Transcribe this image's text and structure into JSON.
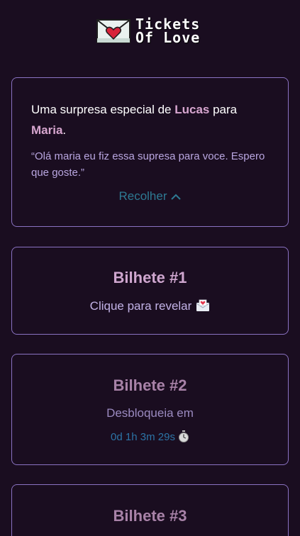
{
  "app": {
    "logo_line1": "Tickets",
    "logo_line2": "Of Love"
  },
  "intro": {
    "prefix": "Uma surpresa especial de ",
    "from_name": "Lucas",
    "connector": " para ",
    "to_name": "Maria",
    "suffix": ".",
    "quote": "“Olá maria eu fiz essa supresa para voce. Espero que goste.”",
    "collapse_label": "Recolher"
  },
  "tickets": [
    {
      "title": "Bilhete #1",
      "status": "Clique para revelar"
    },
    {
      "title": "Bilhete #2",
      "status": "Desbloqueia em",
      "countdown": "0d 1h 3m 29s"
    },
    {
      "title": "Bilhete #3"
    }
  ],
  "colors": {
    "background": "#1a0d20",
    "card_border": "#8a72c2",
    "name_accent": "#d7a6cf",
    "link": "#2e7a93",
    "countdown": "#2c74a6"
  },
  "icons": [
    "love-letter-icon",
    "chevron-up-icon",
    "envelope-heart-icon",
    "stopwatch-icon"
  ]
}
